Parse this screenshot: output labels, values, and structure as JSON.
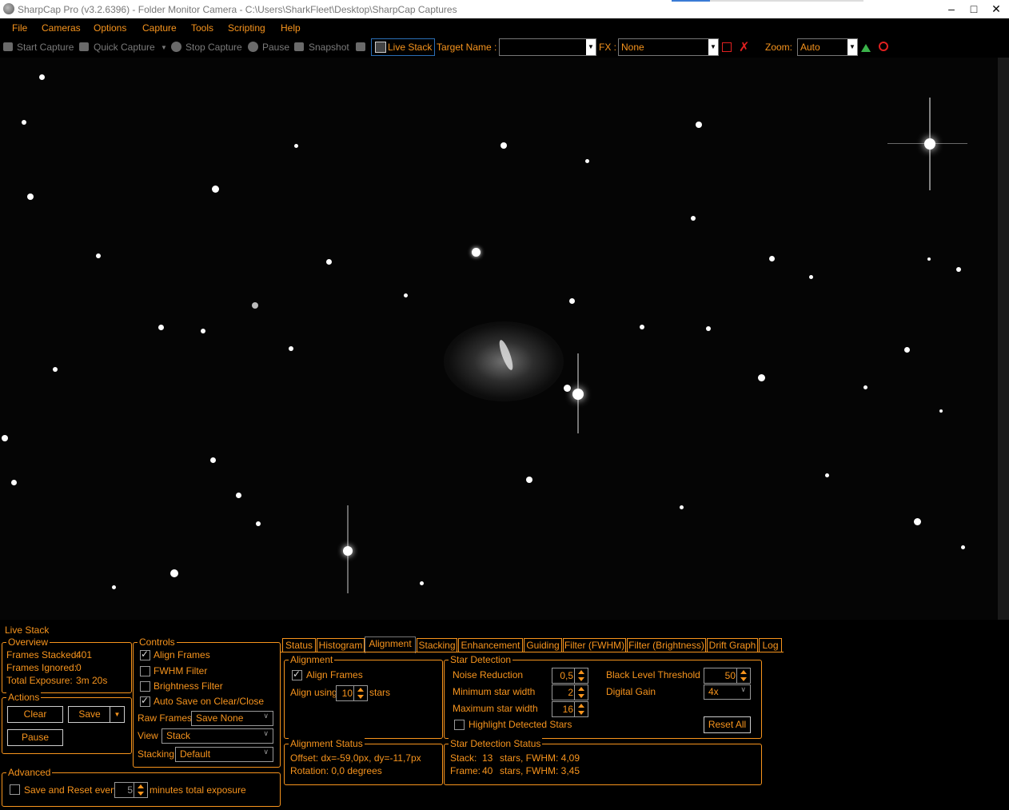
{
  "window": {
    "title": "SharpCap Pro (v3.2.6396) - Folder Monitor Camera - C:\\Users\\SharkFleet\\Desktop\\SharpCap Captures"
  },
  "menu": [
    "File",
    "Cameras",
    "Options",
    "Capture",
    "Tools",
    "Scripting",
    "Help"
  ],
  "toolbar": {
    "start_capture": "Start Capture",
    "quick_capture": "Quick Capture",
    "stop_capture": "Stop Capture",
    "pause": "Pause",
    "snapshot": "Snapshot",
    "live_stack": "Live Stack",
    "target_name_label": "Target Name :",
    "target_name_value": "",
    "fx_label": "FX :",
    "fx_value": "None",
    "zoom_label": "Zoom:",
    "zoom_value": "Auto"
  },
  "live_stack": {
    "title": "Live Stack",
    "overview": {
      "title": "Overview",
      "frames_stacked_label": "Frames Stacked:",
      "frames_stacked": "401",
      "frames_ignored_label": "Frames Ignored:",
      "frames_ignored": "0",
      "total_exposure_label": "Total Exposure:",
      "total_exposure": "3m 20s"
    },
    "controls": {
      "title": "Controls",
      "align_frames": "Align Frames",
      "fwhm_filter": "FWHM Filter",
      "brightness_filter": "Brightness Filter",
      "auto_save": "Auto Save on Clear/Close",
      "raw_frames_label": "Raw Frames",
      "raw_frames_value": "Save None",
      "view_label": "View",
      "view_value": "Stack",
      "stacking_label": "Stacking",
      "stacking_value": "Default"
    },
    "actions": {
      "title": "Actions",
      "clear": "Clear",
      "save": "Save",
      "pause": "Pause"
    },
    "advanced": {
      "title": "Advanced",
      "save_reset_label": "Save and Reset every",
      "save_reset_value": "5",
      "save_reset_suffix": "minutes total exposure"
    },
    "tabs": [
      "Status",
      "Histogram",
      "Alignment",
      "Stacking",
      "Enhancement",
      "Guiding",
      "Filter (FWHM)",
      "Filter (Brightness)",
      "Drift Graph",
      "Log"
    ],
    "active_tab": "Alignment",
    "alignment": {
      "title": "Alignment",
      "align_frames": "Align Frames",
      "align_using_label": "Align using",
      "align_using_value": "10",
      "stars_label": "stars"
    },
    "star_detection": {
      "title": "Star Detection",
      "noise_reduction_label": "Noise Reduction",
      "noise_reduction_value": "0,5",
      "min_star_width_label": "Minimum star width",
      "min_star_width_value": "2",
      "max_star_width_label": "Maximum star width",
      "max_star_width_value": "16",
      "highlight_label": "Highlight Detected Stars",
      "black_level_label": "Black Level Threshold",
      "black_level_value": "50",
      "digital_gain_label": "Digital Gain",
      "digital_gain_value": "4x",
      "reset_all": "Reset All"
    },
    "alignment_status": {
      "title": "Alignment Status",
      "offset": "Offset: dx=-59,0px, dy=-11,7px",
      "rotation": "Rotation: 0,0 degrees"
    },
    "star_detection_status": {
      "title": "Star Detection Status",
      "stack_label": "Stack:",
      "stack_count": "13",
      "stack_fwhm": "stars, FWHM:  4,09",
      "frame_label": "Frame:",
      "frame_count": "40",
      "frame_fwhm": "stars, FWHM:  3,45"
    }
  }
}
